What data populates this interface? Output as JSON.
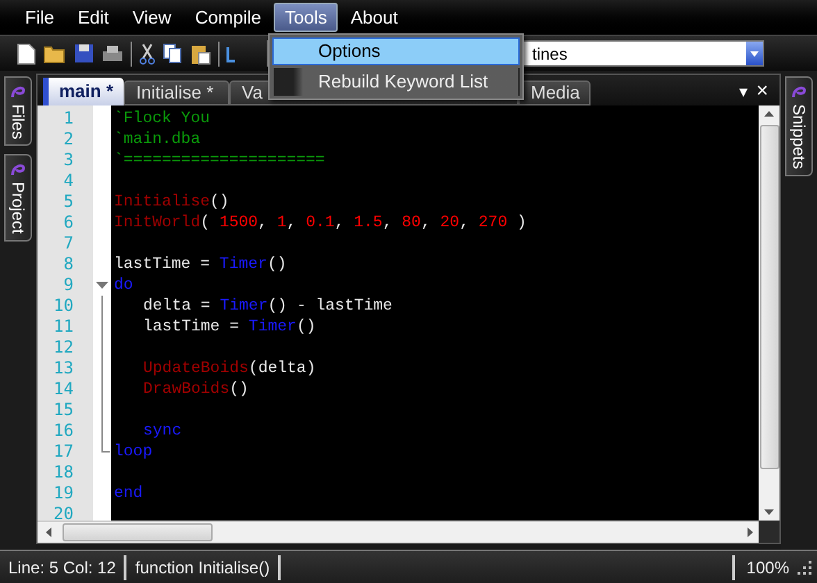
{
  "menu_bar": [
    {
      "label": "File",
      "selected": false
    },
    {
      "label": "Edit",
      "selected": false
    },
    {
      "label": "View",
      "selected": false
    },
    {
      "label": "Compile",
      "selected": false
    },
    {
      "label": "Tools",
      "selected": true
    },
    {
      "label": "About",
      "selected": false
    }
  ],
  "tools_menu": {
    "items": [
      {
        "label": "Options",
        "selected": true
      },
      {
        "label": "Rebuild Keyword List",
        "selected": false
      }
    ]
  },
  "toolbar": {
    "combo_value": "tines"
  },
  "left_panel_tabs": [
    "Files",
    "Project"
  ],
  "right_panel_tabs": [
    "Snippets"
  ],
  "tabs": [
    {
      "label": "main *",
      "selected": true
    },
    {
      "label": "Initialise *",
      "selected": false
    },
    {
      "label": "Va",
      "selected": false
    },
    {
      "label": "Media",
      "selected": false
    }
  ],
  "tab_controls": [
    "▾",
    "×"
  ],
  "editor": {
    "lines": [
      {
        "number": "1",
        "tokens": [
          {
            "kind": "comment",
            "text": "`Flock You"
          }
        ]
      },
      {
        "number": "2",
        "tokens": [
          {
            "kind": "comment",
            "text": "`main.dba"
          }
        ]
      },
      {
        "number": "3",
        "tokens": [
          {
            "kind": "comment",
            "text": "`====================="
          }
        ]
      },
      {
        "number": "4"
      },
      {
        "number": "5",
        "tokens": [
          {
            "kind": "call",
            "text": "Initialise"
          },
          {
            "kind": "text",
            "text": "()"
          }
        ]
      },
      {
        "number": "6",
        "tokens": [
          {
            "kind": "call",
            "text": "InitWorld"
          },
          {
            "kind": "text",
            "text": "( "
          },
          {
            "kind": "number",
            "text": "1500"
          },
          {
            "kind": "text",
            "text": ", "
          },
          {
            "kind": "number",
            "text": "1"
          },
          {
            "kind": "text",
            "text": ", "
          },
          {
            "kind": "number",
            "text": "0.1"
          },
          {
            "kind": "text",
            "text": ", "
          },
          {
            "kind": "number",
            "text": "1.5"
          },
          {
            "kind": "text",
            "text": ", "
          },
          {
            "kind": "number",
            "text": "80"
          },
          {
            "kind": "text",
            "text": ", "
          },
          {
            "kind": "number",
            "text": "20"
          },
          {
            "kind": "text",
            "text": ", "
          },
          {
            "kind": "number",
            "text": "270"
          },
          {
            "kind": "text",
            "text": " )"
          }
        ]
      },
      {
        "number": "7"
      },
      {
        "number": "8",
        "tokens": [
          {
            "kind": "text",
            "text": "lastTime = "
          },
          {
            "kind": "keyword",
            "text": "Timer"
          },
          {
            "kind": "text",
            "text": "()"
          }
        ]
      },
      {
        "number": "9",
        "fold_start": true,
        "tokens": [
          {
            "kind": "keyword",
            "text": "do"
          }
        ]
      },
      {
        "number": "10",
        "in_fold": true,
        "indented": true,
        "tokens": [
          {
            "kind": "text",
            "text": "delta = "
          },
          {
            "kind": "keyword",
            "text": "Timer"
          },
          {
            "kind": "text",
            "text": "() - lastTime"
          }
        ]
      },
      {
        "number": "11",
        "in_fold": true,
        "indented": true,
        "tokens": [
          {
            "kind": "text",
            "text": "lastTime = "
          },
          {
            "kind": "keyword",
            "text": "Timer"
          },
          {
            "kind": "text",
            "text": "()"
          }
        ]
      },
      {
        "number": "12",
        "in_fold": true
      },
      {
        "number": "13",
        "in_fold": true,
        "indented": true,
        "tokens": [
          {
            "kind": "call",
            "text": "UpdateBoids"
          },
          {
            "kind": "text",
            "text": "(delta)"
          }
        ]
      },
      {
        "number": "14",
        "in_fold": true,
        "indented": true,
        "tokens": [
          {
            "kind": "call",
            "text": "DrawBoids"
          },
          {
            "kind": "text",
            "text": "()"
          }
        ]
      },
      {
        "number": "15",
        "in_fold": true
      },
      {
        "number": "16",
        "in_fold": true,
        "indented": true,
        "tokens": [
          {
            "kind": "keyword",
            "text": "sync"
          }
        ]
      },
      {
        "number": "17",
        "fold_end": true,
        "tokens": [
          {
            "kind": "keyword",
            "text": "loop"
          }
        ]
      },
      {
        "number": "18"
      },
      {
        "number": "19",
        "tokens": [
          {
            "kind": "keyword",
            "text": "end"
          }
        ]
      },
      {
        "number": "20"
      }
    ]
  },
  "status_bar": {
    "position": "Line: 5 Col: 12",
    "context": "function Initialise()",
    "zoom": "100%"
  }
}
